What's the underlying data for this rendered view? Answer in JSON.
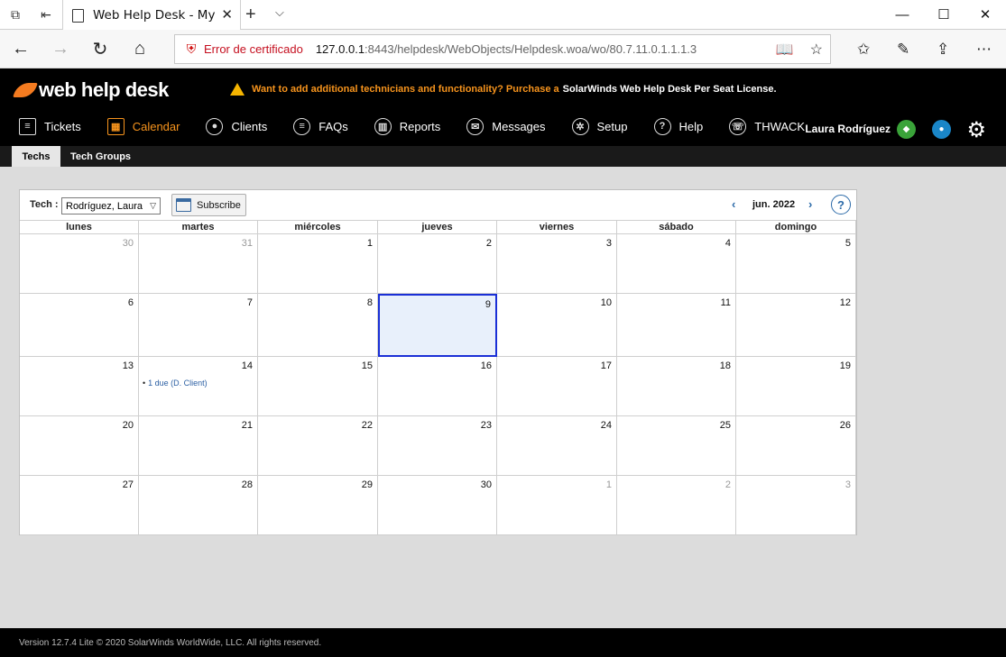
{
  "browser": {
    "tab_title": "Web Help Desk - My Ca",
    "cert_error": "Error de certificado",
    "url_host": "127.0.0.1",
    "url_rest": ":8443/helpdesk/WebObjects/Helpdesk.woa/wo/80.7.11.0.1.1.1.3"
  },
  "app": {
    "logo_text": "web help desk",
    "promo_question": "Want to add additional technicians and functionality? Purchase a",
    "promo_link": "SolarWinds Web Help Desk Per Seat License.",
    "nav": [
      {
        "label": "Tickets",
        "icon": "list-icon",
        "glyph": "≡"
      },
      {
        "label": "Calendar",
        "icon": "calendar-icon",
        "glyph": "▦",
        "active": true
      },
      {
        "label": "Clients",
        "icon": "user-icon",
        "glyph": "●"
      },
      {
        "label": "FAQs",
        "icon": "faq-list-icon",
        "glyph": "≡"
      },
      {
        "label": "Reports",
        "icon": "report-icon",
        "glyph": "▥"
      },
      {
        "label": "Messages",
        "icon": "envelope-icon",
        "glyph": "✉"
      },
      {
        "label": "Setup",
        "icon": "setup-gear-icon",
        "glyph": "✲"
      },
      {
        "label": "Help",
        "icon": "help-icon",
        "glyph": "?"
      },
      {
        "label": "THWACK",
        "icon": "thwack-icon",
        "glyph": "☏"
      }
    ],
    "user_name": "Laura Rodríguez",
    "subtabs": [
      "Techs",
      "Tech Groups"
    ]
  },
  "calendar": {
    "tech_label": "Tech :",
    "tech_value": "Rodríguez, Laura",
    "subscribe_label": "Subscribe",
    "month_label": "jun. 2022",
    "help_glyph": "?",
    "weekdays": [
      "lunes",
      "martes",
      "miércoles",
      "jueves",
      "viernes",
      "sábado",
      "domingo"
    ],
    "weeks": [
      [
        {
          "d": "30",
          "o": true
        },
        {
          "d": "31",
          "o": true
        },
        {
          "d": "1"
        },
        {
          "d": "2"
        },
        {
          "d": "3"
        },
        {
          "d": "4"
        },
        {
          "d": "5"
        }
      ],
      [
        {
          "d": "6"
        },
        {
          "d": "7"
        },
        {
          "d": "8"
        },
        {
          "d": "9",
          "today": true
        },
        {
          "d": "10"
        },
        {
          "d": "11"
        },
        {
          "d": "12"
        }
      ],
      [
        {
          "d": "13"
        },
        {
          "d": "14",
          "event": "1 due (D. Client)"
        },
        {
          "d": "15"
        },
        {
          "d": "16"
        },
        {
          "d": "17"
        },
        {
          "d": "18"
        },
        {
          "d": "19"
        }
      ],
      [
        {
          "d": "20"
        },
        {
          "d": "21"
        },
        {
          "d": "22"
        },
        {
          "d": "23"
        },
        {
          "d": "24"
        },
        {
          "d": "25"
        },
        {
          "d": "26"
        }
      ],
      [
        {
          "d": "27"
        },
        {
          "d": "28"
        },
        {
          "d": "29"
        },
        {
          "d": "30"
        },
        {
          "d": "1",
          "o": true
        },
        {
          "d": "2",
          "o": true
        },
        {
          "d": "3",
          "o": true
        }
      ]
    ]
  },
  "footer_text": "Version 12.7.4 Lite © 2020 SolarWinds WorldWide, LLC. All rights reserved.",
  "colors": {
    "accent": "#f7941d",
    "today_border": "#1a2fd6",
    "link": "#2b6aa8"
  }
}
